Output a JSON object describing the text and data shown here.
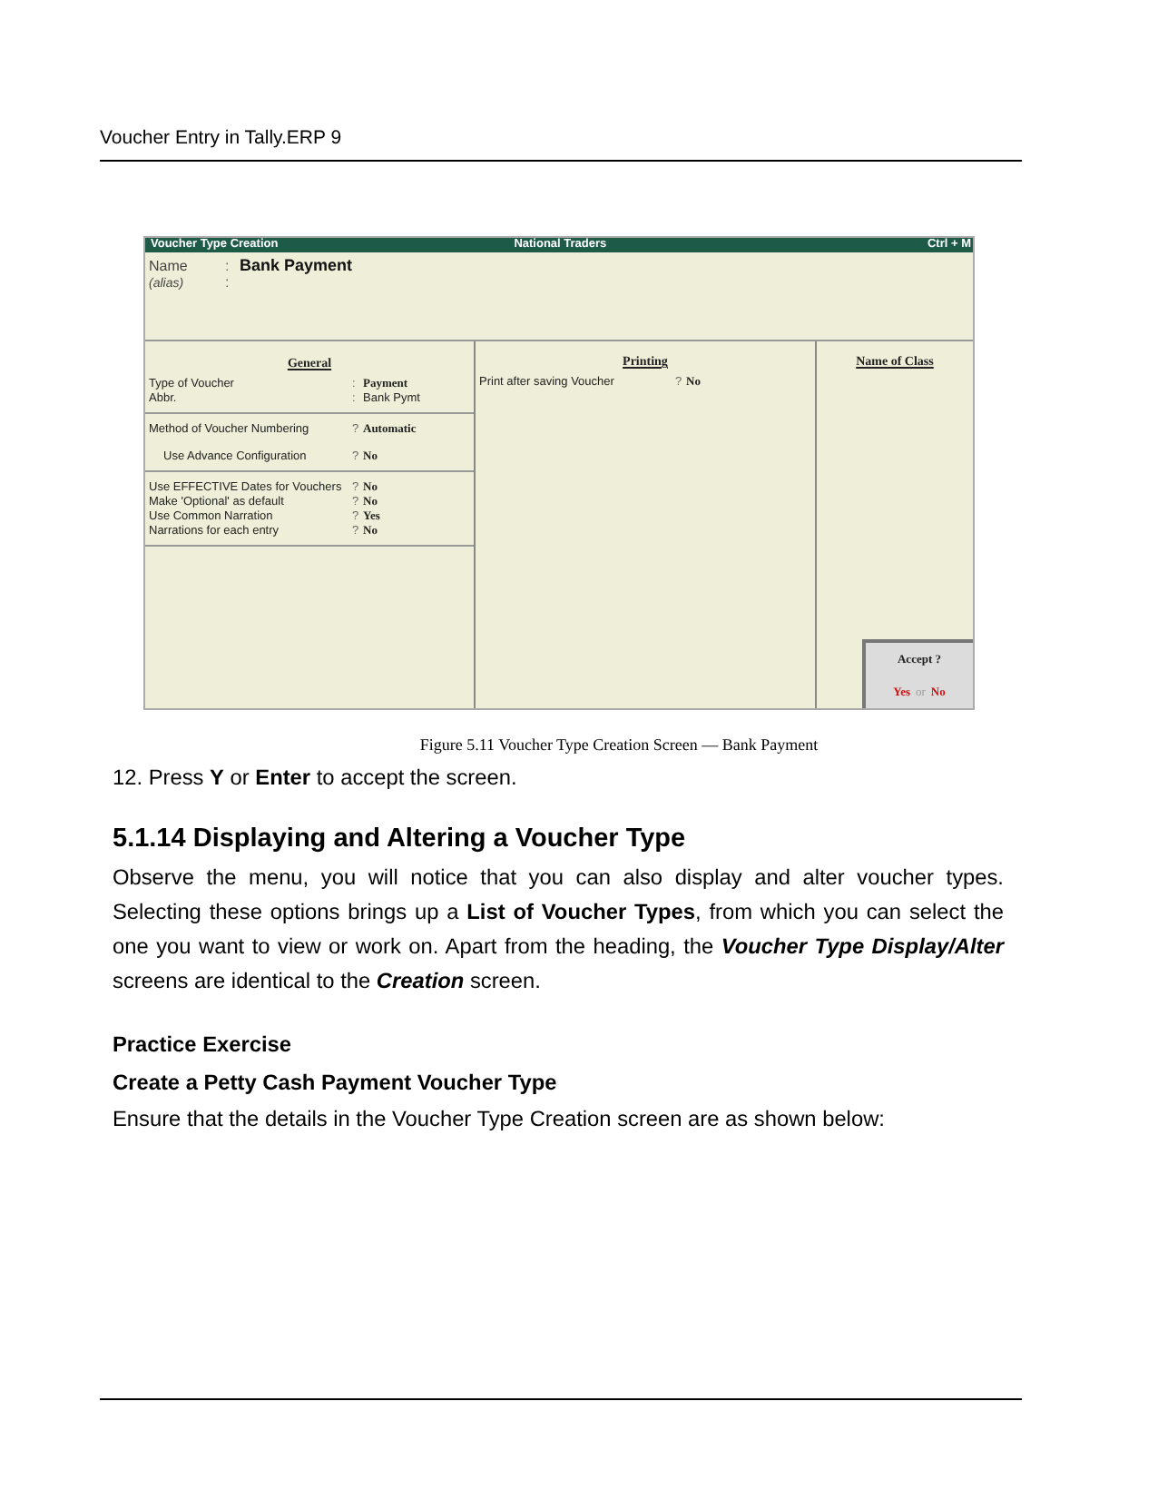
{
  "header": {
    "title": "Voucher Entry in Tally.ERP 9"
  },
  "figure": {
    "title_bar": {
      "title": "Voucher Type Creation",
      "company": "National Traders",
      "shortcut": "Ctrl + M"
    },
    "name": {
      "label": "Name",
      "separator": ":",
      "value": "Bank Payment"
    },
    "alias": {
      "label": "(alias)",
      "separator": ":"
    },
    "general": {
      "heading": "General",
      "sections": [
        [
          {
            "label": "Type of Voucher",
            "prompt": ":",
            "value": "Payment",
            "emphasis": true
          },
          {
            "label": "Abbr.",
            "prompt": ":",
            "value": "Bank Pymt",
            "emphasis": false
          }
        ],
        [
          {
            "label": "Method of Voucher Numbering",
            "prompt": "?",
            "value": "Automatic",
            "emphasis": true,
            "children": [
              {
                "label": "Use Advance Configuration",
                "prompt": "?",
                "value": "No",
                "emphasis": true
              }
            ]
          }
        ],
        [
          {
            "label": "Use EFFECTIVE Dates for Vouchers",
            "prompt": "?",
            "value": "No",
            "emphasis": true
          },
          {
            "label": "Make 'Optional' as default",
            "prompt": "?",
            "value": "No",
            "emphasis": true
          },
          {
            "label": "Use Common Narration",
            "prompt": "?",
            "value": "Yes",
            "emphasis": true
          },
          {
            "label": "Narrations for each entry",
            "prompt": "?",
            "value": "No",
            "emphasis": true
          }
        ]
      ]
    },
    "printing": {
      "heading": "Printing",
      "rows": [
        {
          "label": "Print after saving Voucher",
          "prompt": "?",
          "value": "No",
          "emphasis": true
        }
      ]
    },
    "class": {
      "heading": "Name of Class"
    },
    "accept": {
      "question": "Accept ?",
      "yes": "Yes",
      "or": "or",
      "no": "No"
    },
    "caption": "Figure 5.11 Voucher Type Creation Screen — Bank Payment"
  },
  "body": [
    {
      "kind": "paragraph",
      "text": "12. Press **Y** or **Enter** to accept the screen."
    },
    {
      "kind": "heading",
      "text": "5.1.14 Displaying and Altering a Voucher Type"
    },
    {
      "kind": "paragraph",
      "text": "Observe the menu, you will notice that you can also display and alter voucher types. Selecting these options brings up a **List of Voucher Types**, from which you can select the one you want to view or work on. Apart from the heading, the *Voucher Type Display/Alter* screens are identical to the *Creation* screen."
    },
    {
      "kind": "subheading",
      "text": "Practice Exercise"
    },
    {
      "kind": "subheading",
      "text": "Create a Petty Cash Payment Voucher Type"
    },
    {
      "kind": "paragraph",
      "text": "Ensure that the details in the Voucher Type Creation screen are as shown below:"
    }
  ]
}
